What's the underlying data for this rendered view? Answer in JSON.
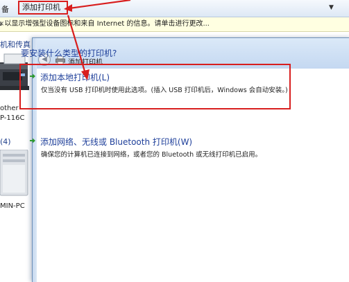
{
  "toolbar": {
    "left_label": "备",
    "add_printer_label": "添加打印机",
    "dropdown_glyph": "▼"
  },
  "infobar": {
    "text": "s 以显示增强型设备图标和来自 Internet 的信息。请单击进行更改...",
    "close_glyph": "×"
  },
  "background": {
    "heading": "机和传真",
    "printer_line1": "other",
    "printer_line2": "P-116C",
    "device_count": "(4)",
    "pc_label": "MIN-PC"
  },
  "dialog": {
    "title": "添加打印机",
    "question": "要安装什么类型的打印机?",
    "options": [
      {
        "title": "添加本地打印机(L)",
        "description": "仅当没有 USB 打印机时使用此选项。(插入 USB 打印机后，Windows 会自动安装。)"
      },
      {
        "title": "添加网络、无线或 Bluetooth 打印机(W)",
        "description": "确保您的计算机已连接到网络，或者您的 Bluetooth 或无线打印机已启用。"
      }
    ]
  },
  "colors": {
    "annotation_red": "#d81e1e",
    "link_blue": "#1e3f9a",
    "green_arrow": "#2e9a2e"
  },
  "icons": [
    "printer-icon",
    "back-arrow-icon",
    "green-arrow-icon",
    "close-icon",
    "dropdown-icon"
  ]
}
